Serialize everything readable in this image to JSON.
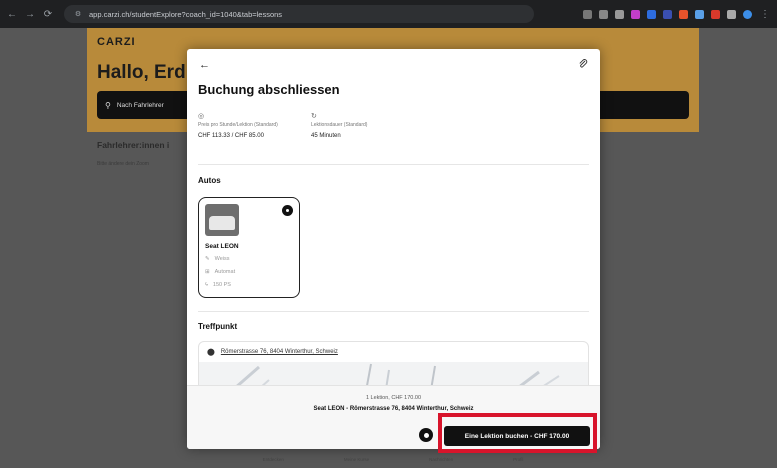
{
  "browser": {
    "url": "app.carzi.ch/studentExplore?coach_id=1040&tab=lessons"
  },
  "background": {
    "logo": "CARZI",
    "greeting": "Hallo, Erd",
    "search_label": "Nach Fahrlehrer",
    "section_title": "Fahrlehrer:innen i",
    "section_sub": "Bitte ändere dein Zoom",
    "nav": [
      "Entdecken",
      "Meine Kurse",
      "Nachrichten",
      "Profil"
    ]
  },
  "modal": {
    "back_icon": "←",
    "link_icon": "⌀",
    "title": "Buchung abschliessen",
    "price_label": "Preis pro Stunde/Lektion (Standard)",
    "price_value": "CHF 113.33 / CHF 85.00",
    "duration_label": "Lektionsdauer (Standard)",
    "duration_value": "45 Minuten",
    "cars_title": "Autos",
    "car": {
      "name": "Seat LEON",
      "color": "Weiss",
      "gearbox": "Automat",
      "power": "150 PS"
    },
    "meeting_title": "Treffpunkt",
    "address": "Römerstrasse 76, 8404 Winterthur, Schweiz"
  },
  "footer": {
    "summary": "1 Lektion, CHF 170.00",
    "detail": "Seat LEON - Römerstrasse 76, 8404 Winterthur, Schweiz",
    "book_label": "Eine Lektion buchen - CHF 170.00"
  },
  "colors": {
    "accent": "#b88a3a",
    "highlight": "#d8142b"
  }
}
